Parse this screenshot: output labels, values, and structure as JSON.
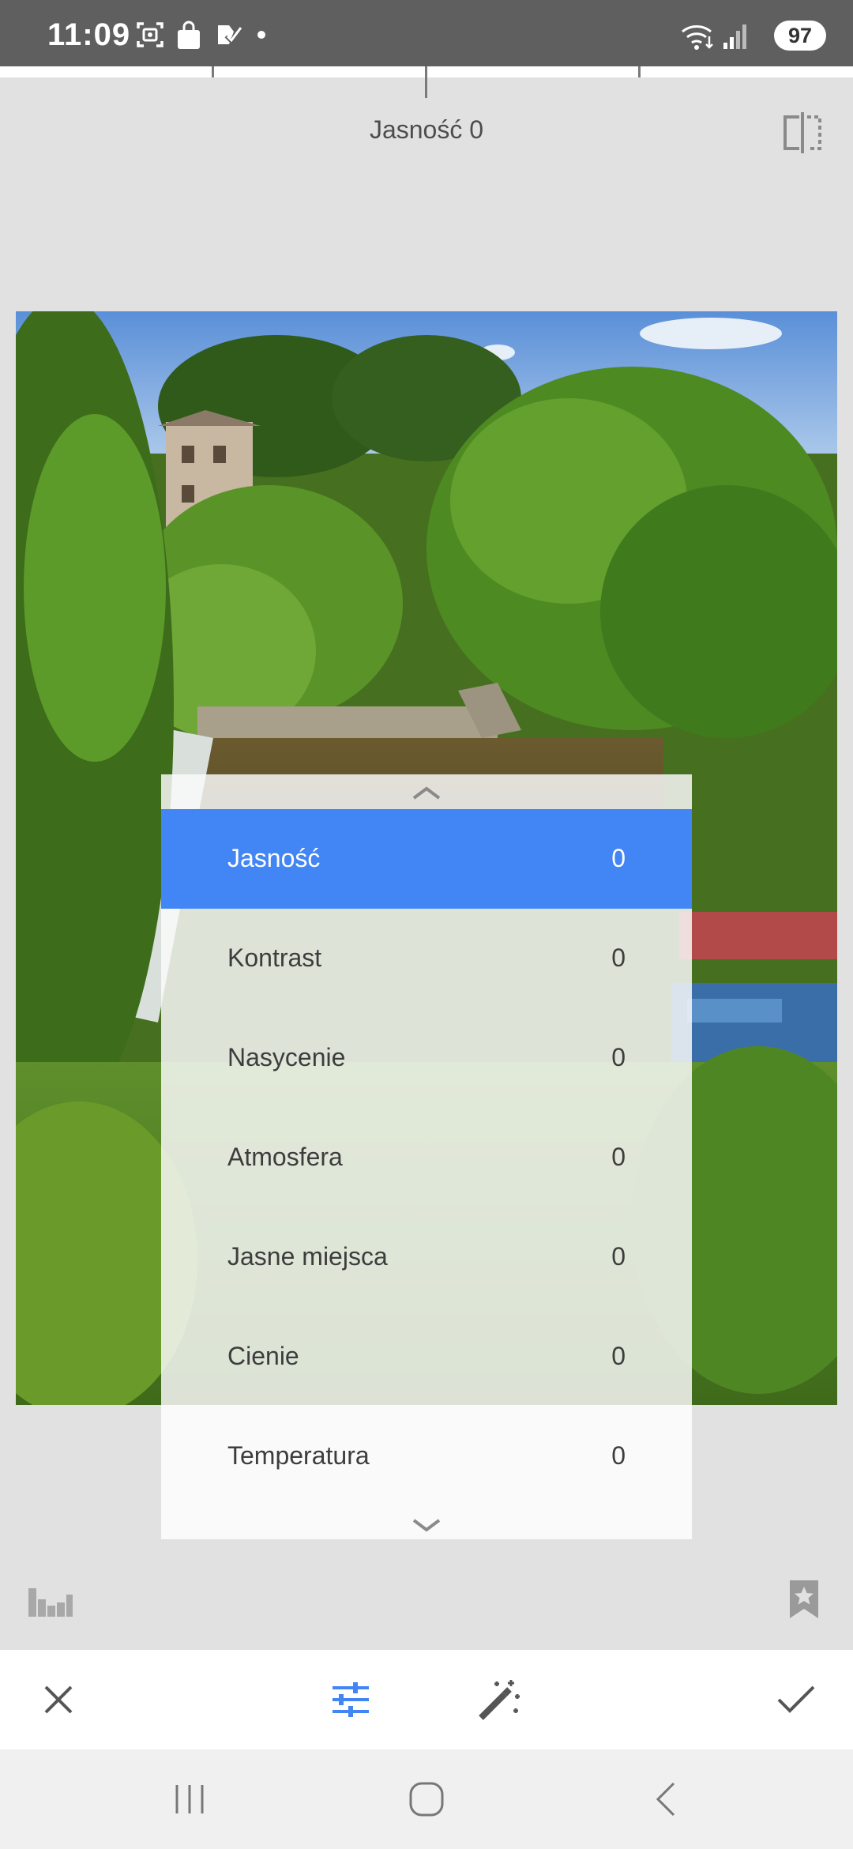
{
  "status_bar": {
    "time": "11:09",
    "battery": "97",
    "icons_left": [
      "screenshot-icon",
      "shopping-bag-icon",
      "task-check-icon",
      "dot-icon"
    ],
    "icons_right": [
      "wifi-icon",
      "signal-icon",
      "battery-icon"
    ]
  },
  "header": {
    "param_label": "Jasność 0",
    "compare_icon": "compare-split-icon"
  },
  "menu": {
    "items": [
      {
        "label": "Jasność",
        "value": "0",
        "active": true
      },
      {
        "label": "Kontrast",
        "value": "0"
      },
      {
        "label": "Nasycenie",
        "value": "0"
      },
      {
        "label": "Atmosfera",
        "value": "0"
      },
      {
        "label": "Jasne miejsca",
        "value": "0"
      },
      {
        "label": "Cienie",
        "value": "0"
      },
      {
        "label": "Temperatura",
        "value": "0"
      }
    ],
    "scroll_up_icon": "chevron-up-icon",
    "scroll_down_icon": "chevron-down-icon"
  },
  "toolbar": {
    "cancel_icon": "close-icon",
    "adjust_icon": "tune-sliders-icon",
    "auto_icon": "magic-wand-icon",
    "apply_icon": "check-icon"
  },
  "extras": {
    "histogram_icon": "histogram-icon",
    "styles_icon": "bookmark-star-icon"
  },
  "colors": {
    "accent": "#4285f4",
    "status_bar": "#5f5f5f",
    "background": "#e1e1e1"
  }
}
